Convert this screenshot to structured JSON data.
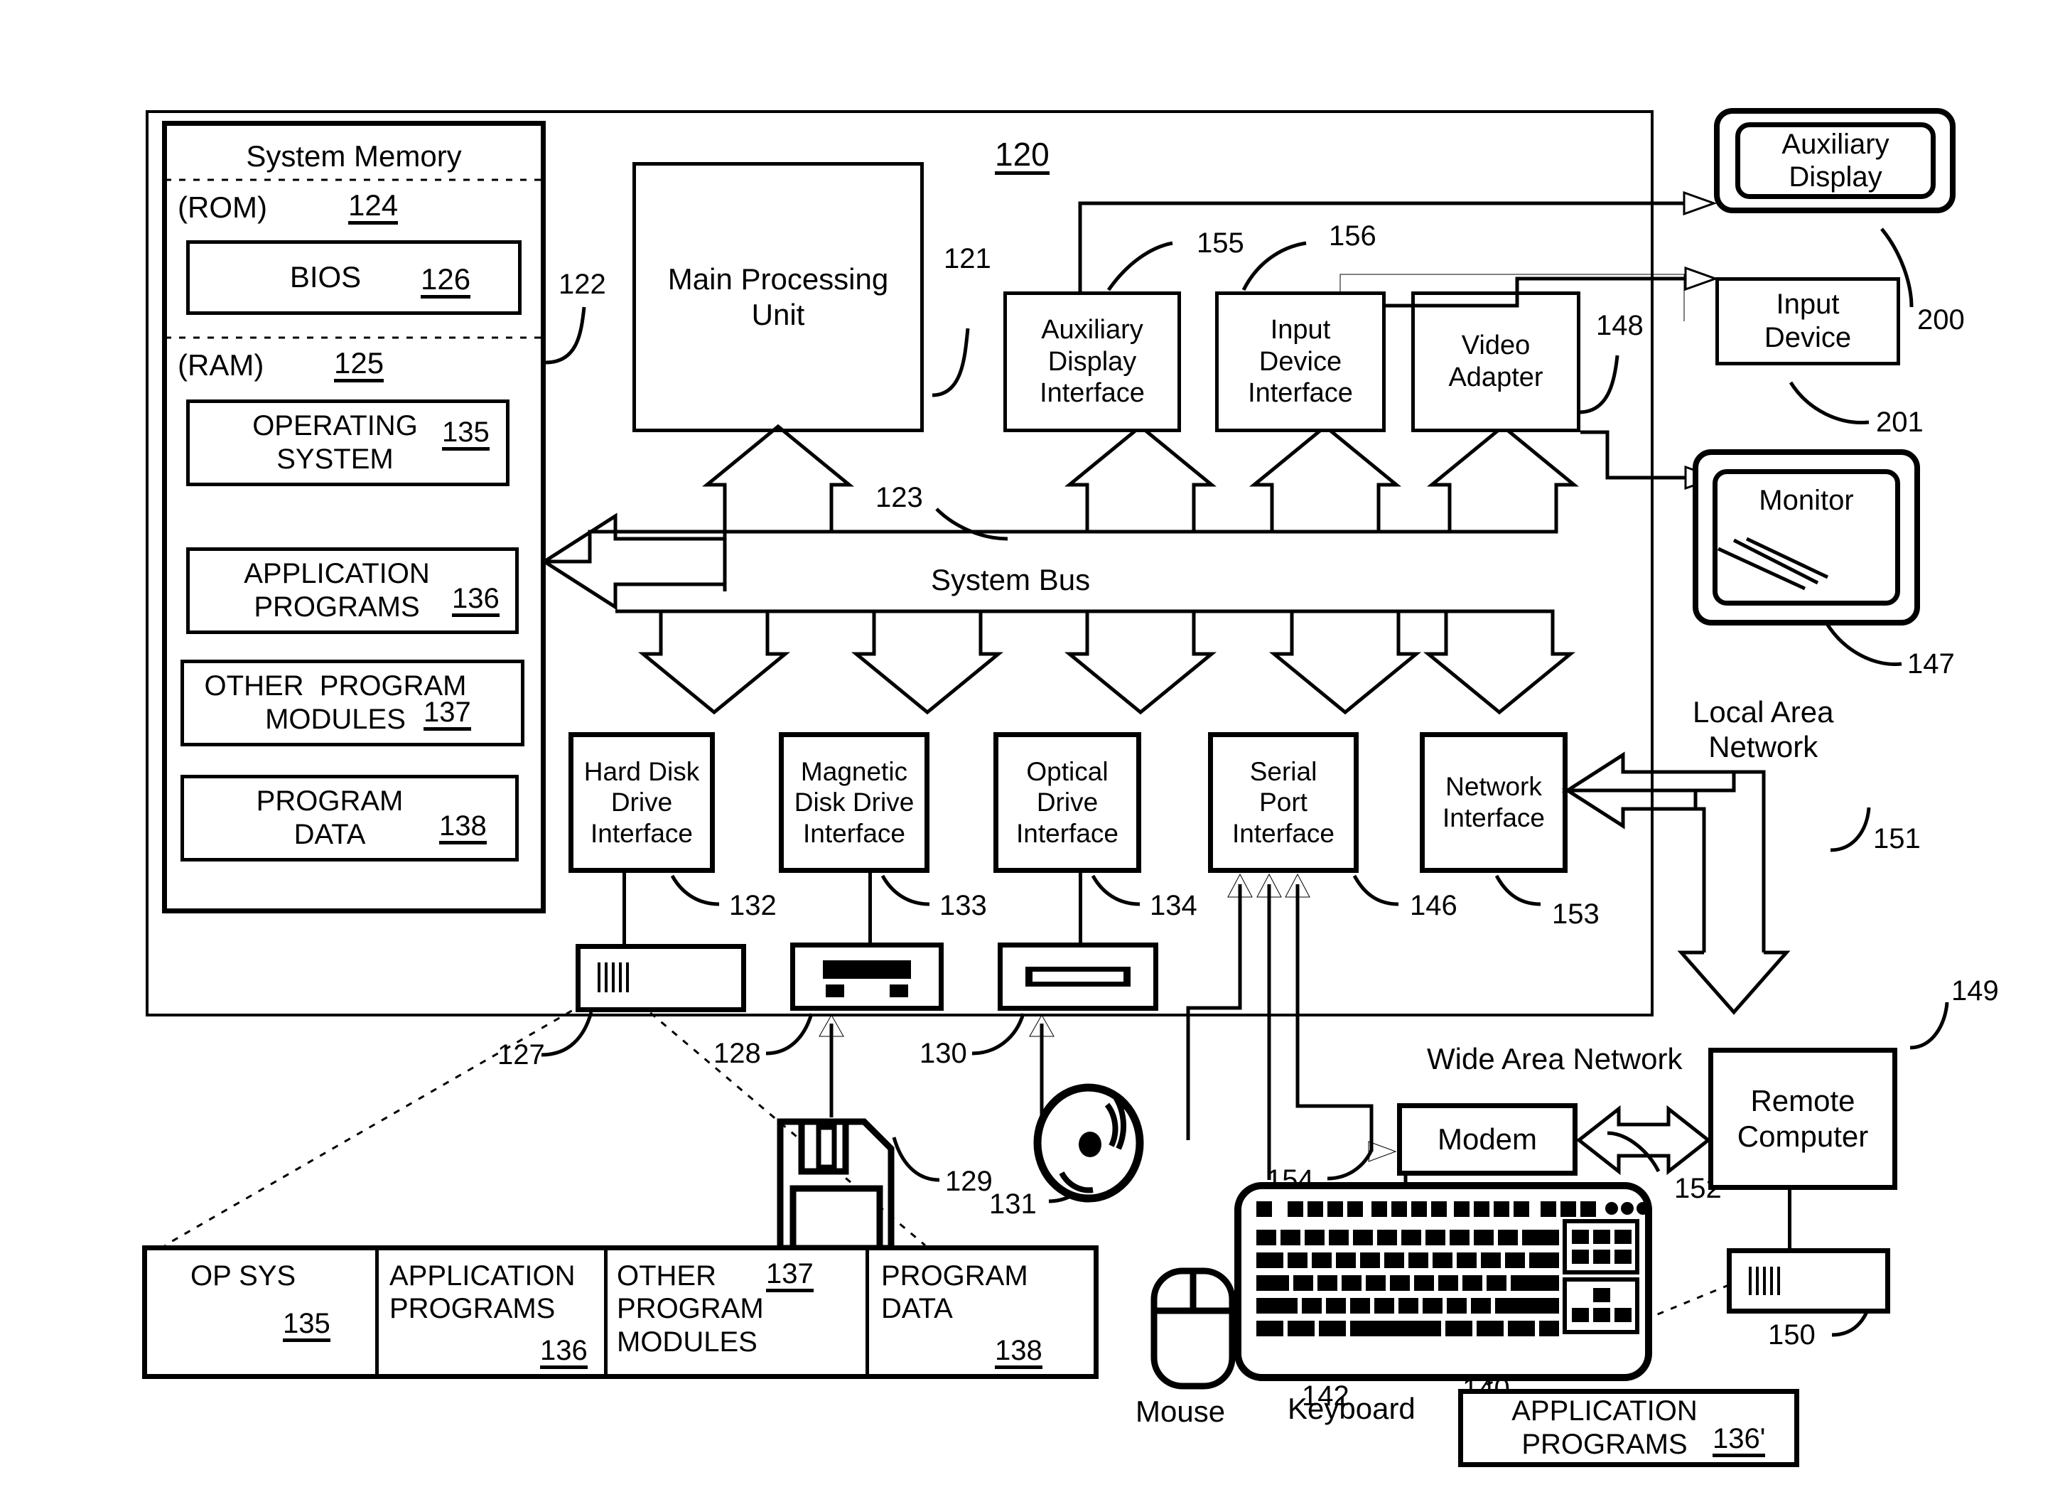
{
  "figure": {
    "system_ref": "120",
    "memory": {
      "title": "System Memory",
      "rom_label": "(ROM)",
      "rom_ref": "124",
      "bios_label": "BIOS",
      "bios_ref": "126",
      "ram_label": "(RAM)",
      "ram_ref": "125",
      "os_label": "OPERATING\nSYSTEM",
      "os_ref": "135",
      "app_label": "APPLICATION\nPROGRAMS",
      "app_ref": "136",
      "other_label": "OTHER  PROGRAM\nMODULES",
      "other_ref": "137",
      "data_label": "PROGRAM\nDATA",
      "data_ref": "138",
      "bus_ref": "122"
    },
    "cpu": {
      "label": "Main Processing\nUnit",
      "ref": "121"
    },
    "bus": {
      "label": "System Bus",
      "ref": "123"
    },
    "interfaces_top": [
      {
        "label": "Auxiliary\nDisplay\nInterface",
        "ref": "155"
      },
      {
        "label": "Input\nDevice\nInterface",
        "ref": "156"
      },
      {
        "label": "Video\nAdapter",
        "ref": "148"
      }
    ],
    "interfaces_bottom": [
      {
        "label": "Hard Disk\nDrive\nInterface",
        "ref": "132"
      },
      {
        "label": "Magnetic\nDisk Drive\nInterface",
        "ref": "133"
      },
      {
        "label": "Optical\nDrive\nInterface",
        "ref": "134"
      },
      {
        "label": "Serial\nPort\nInterface",
        "ref": "146"
      },
      {
        "label": "Network\nInterface",
        "ref": "153"
      }
    ],
    "drives": [
      {
        "name": "hard-disk-drive",
        "ref": "127"
      },
      {
        "name": "magnetic-disk-drive",
        "ref": "128"
      },
      {
        "name": "optical-drive",
        "ref": "130"
      }
    ],
    "media": [
      {
        "name": "floppy-disk",
        "ref": "129"
      },
      {
        "name": "optical-disc",
        "ref": "131"
      }
    ],
    "peripherals": {
      "auxiliary_display": {
        "label": "Auxiliary\nDisplay",
        "ref": "200"
      },
      "input_device": {
        "label": "Input\nDevice",
        "ref": "201"
      },
      "monitor": {
        "label": "Monitor",
        "ref": "147"
      },
      "keyboard": {
        "label": "Keyboard",
        "ref": "140"
      },
      "mouse": {
        "label": "Mouse",
        "ref": "142"
      }
    },
    "network": {
      "lan_label": "Local Area\nNetwork",
      "lan_ref": "151",
      "wan_label": "Wide Area Network",
      "wan_ref": "152",
      "modem_label": "Modem",
      "modem_ref": "154",
      "remote_label": "Remote\nComputer",
      "remote_ref": "149",
      "remote_drive_ref": "150"
    },
    "storage_table": {
      "cells": [
        {
          "label": "OP SYS",
          "ref": "135"
        },
        {
          "label": "APPLICATION\nPROGRAMS",
          "ref": "136"
        },
        {
          "label": "OTHER\nPROGRAM\nMODULES",
          "ref": "137"
        },
        {
          "label": "PROGRAM\nDATA",
          "ref": "138"
        }
      ]
    },
    "remote_apps": {
      "label": "APPLICATION\nPROGRAMS",
      "ref": "136'"
    }
  }
}
